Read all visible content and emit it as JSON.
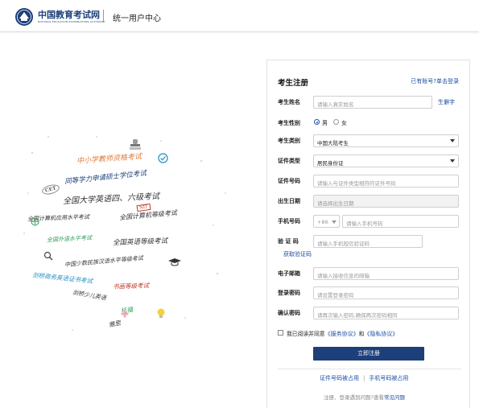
{
  "header": {
    "brand": "中国教育考试网",
    "brand_sub": "NATIONAL EDUCATION EXAMINATIONS AUTHORITY",
    "center_title": "统一用户中心"
  },
  "word_cloud": [
    {
      "text": "中小学教师资格考试",
      "color": "#e07b3c"
    },
    {
      "text": "同等学力申请硕士学位考试",
      "color": "#1d3f7a"
    },
    {
      "text": "全国大学英语四、六级考试",
      "color": "#333333"
    },
    {
      "text": "全国计算机应用水平考试",
      "color": "#333333"
    },
    {
      "text": "全国计算机等级考试",
      "color": "#333333"
    },
    {
      "text": "全国外语水平考试",
      "color": "#2e9e5a"
    },
    {
      "text": "全国英语等级考试",
      "color": "#333333"
    },
    {
      "text": "中国少数民族汉语水平等级考试",
      "color": "#333333"
    },
    {
      "text": "剑桥商务英语证书考试",
      "color": "#1d8fc7"
    },
    {
      "text": "书画等级考试",
      "color": "#c0392b"
    },
    {
      "text": "剑桥少儿英语",
      "color": "#333333"
    },
    {
      "text": "托福",
      "color": "#2e9e5a"
    },
    {
      "text": "雅思",
      "color": "#333333"
    },
    {
      "text": "CET",
      "color": "#555555"
    },
    {
      "text": "NIT",
      "color": "#c0392b"
    }
  ],
  "form": {
    "title": "考生注册",
    "login_link": "已有账号?单击登录",
    "name": {
      "label": "考生姓名",
      "placeholder": "请输入真实姓名",
      "extra": "生僻字"
    },
    "gender": {
      "label": "考生性别",
      "options": [
        "男",
        "女"
      ],
      "selected": "男"
    },
    "category": {
      "label": "考生类别",
      "value": "中国大陆考生"
    },
    "id_type": {
      "label": "证件类型",
      "value": "居民身份证"
    },
    "id_number": {
      "label": "证件号码",
      "placeholder": "请输入与证件类型相符的证件号码"
    },
    "birth": {
      "label": "出生日期",
      "placeholder": "请选择出生日期"
    },
    "phone": {
      "label": "手机号码",
      "prefix": "+86",
      "placeholder": "请输入手机号码"
    },
    "code": {
      "label": "验 证 码",
      "placeholder": "请输入手机短信验证码",
      "get_code": "获取验证码"
    },
    "email": {
      "label": "电子邮箱",
      "placeholder": "请输入接收信息的邮箱"
    },
    "password": {
      "label": "登录密码",
      "placeholder": "请设置登录密码"
    },
    "confirm": {
      "label": "确认密码",
      "placeholder": "请再次输入密码,确保两次密码相同"
    },
    "agree": {
      "pre": "我已阅读并同意",
      "service": "《服务协议》",
      "and": "和",
      "privacy": "《隐私协议》"
    },
    "submit": "立即注册",
    "bottom_links": [
      "证件号码被占用",
      "手机号码被占用"
    ],
    "help_pre": "注册、登录遇到问题?查看",
    "help_link": "常见问题"
  }
}
